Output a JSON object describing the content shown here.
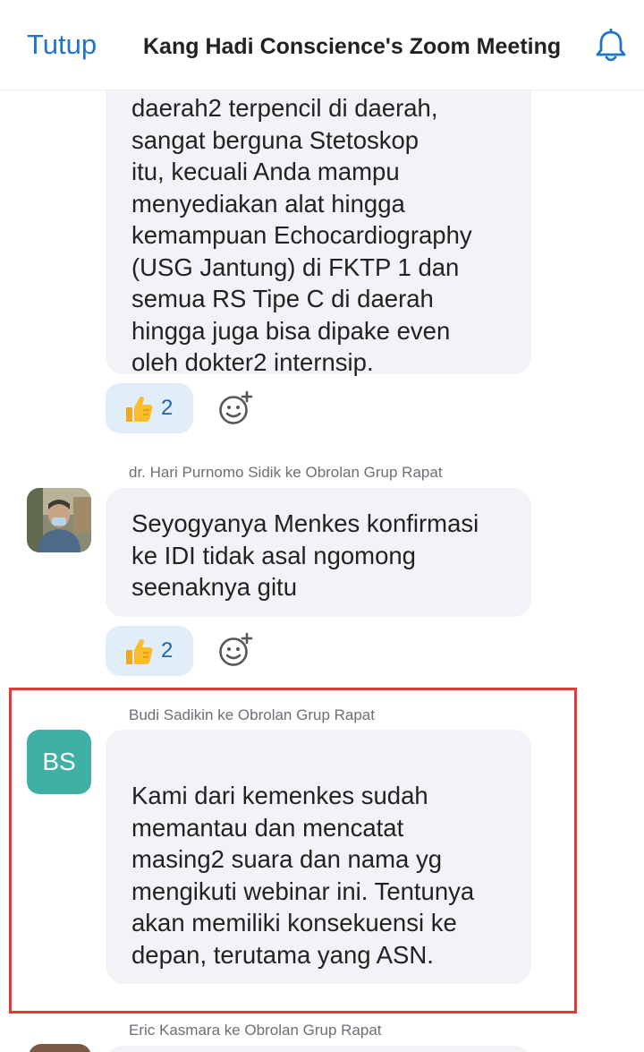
{
  "header": {
    "close_label": "Tutup",
    "title": "Kang Hadi Conscience's Zoom Meeting",
    "bell_icon": "bell-icon"
  },
  "messages": [
    {
      "text": "daerah2 terpencil di daerah,\nsangat berguna Stetoskop\nitu, kecuali Anda mampu\nmenyediakan alat hingga\nkemampuan Echocardiography\n(USG Jantung) di FKTP 1 dan\nsemua RS Tipe C di daerah\nhingga juga bisa dipake even\noleh dokter2 internsip.",
      "reaction": {
        "emoji_icon": "thumbs-up-icon",
        "count": "2"
      }
    },
    {
      "sender": "dr.  Hari Purnomo Sidik ke Obrolan Grup Rapat",
      "avatar": "photo",
      "text": "Seyogyanya Menkes konfirmasi\nke IDI tidak asal ngomong\nseenaknya gitu",
      "reaction": {
        "emoji_icon": "thumbs-up-icon",
        "count": "2"
      }
    },
    {
      "sender": "Budi Sadikin ke Obrolan Grup Rapat",
      "avatar_initials": "BS",
      "text": "Kami dari kemenkes sudah\nmemantau dan mencatat\nmasing2 suara dan nama yg\nmengikuti webinar ini. Tentunya\nakan memiliki konsekuensi ke\ndepan, terutama yang ASN."
    },
    {
      "sender": "Eric Kasmara ke Obrolan Grup Rapat"
    }
  ],
  "colors": {
    "accent": "#1f73c9",
    "bubble": "#f3f3f7",
    "reaction_chip": "#e1eefa",
    "avatar_bs": "#3fb0a3",
    "highlight": "#e23b35"
  }
}
